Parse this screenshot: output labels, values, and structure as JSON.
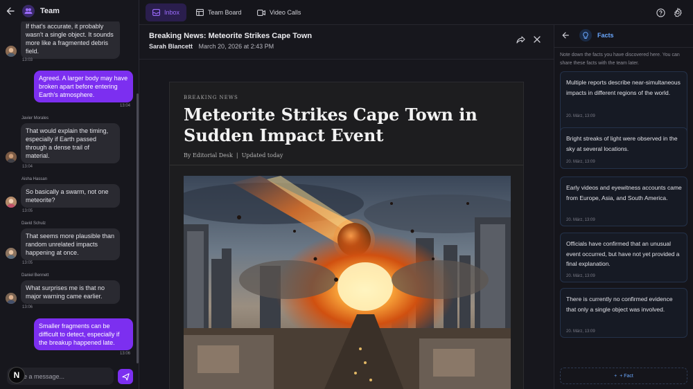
{
  "chat": {
    "title": "Team",
    "composer_placeholder": "Type a message...",
    "composer_visible": "e a message...",
    "messages": [
      {
        "kind": "in",
        "text": "If that's accurate, it probably wasn't a single object. It sounds more like a fragmented debris field.",
        "time": "13:03"
      },
      {
        "kind": "out",
        "text": "Agreed. A larger body may have broken apart before entering Earth's atmosphere.",
        "time": "13:04"
      },
      {
        "kind": "in",
        "sender": "Javier Morales",
        "text": "That would explain the timing, especially if Earth passed through a dense trail of material.",
        "time": "13:04"
      },
      {
        "kind": "in",
        "sender": "Aisha Hassan",
        "text": "So basically a swarm, not one meteorite?",
        "time": "13:05"
      },
      {
        "kind": "in",
        "sender": "David Schulz",
        "text": "That seems more plausible than random unrelated impacts happening at once.",
        "time": "13:05"
      },
      {
        "kind": "in",
        "sender": "Daniel Bennett",
        "text": "What surprises me is that no major warning came earlier.",
        "time": "13:06"
      },
      {
        "kind": "out",
        "text": "Smaller fragments can be difficult to detect, especially if the breakup happened late.",
        "time": "13:06"
      }
    ]
  },
  "nav": {
    "tabs": [
      {
        "label": "Inbox",
        "icon": "inbox-icon"
      },
      {
        "label": "Team Board",
        "icon": "board-icon"
      },
      {
        "label": "Video Calls",
        "icon": "video-icon"
      }
    ]
  },
  "article": {
    "email_title": "Breaking News: Meteorite Strikes Cape Town",
    "author": "Sarah Blancett",
    "date": "March 20, 2026 at 2:43 PM",
    "kicker": "BREAKING NEWS",
    "headline": "Meteorite Strikes Cape Town in Sudden Impact Event",
    "byline": "By Editorial Desk",
    "updated": "Updated today"
  },
  "facts": {
    "title": "Facts",
    "note": "Note down the facts you have discovered here. You can share these facts with the team later.",
    "add_label": "+ Fact",
    "items": [
      {
        "text": "Multiple reports describe near-simultaneous impacts in different regions of the world.",
        "date": "20. März, 13:09"
      },
      {
        "text": "Bright streaks of light were observed in the sky at several locations.",
        "date": "20. März, 13:09"
      },
      {
        "text": "Early videos and eyewitness accounts came from Europe, Asia, and South America.",
        "date": "20. März, 13:09"
      },
      {
        "text": "Officials have confirmed that an unusual event occurred, but have not yet provided a final explanation.",
        "date": "20. März, 13:09"
      },
      {
        "text": "There is currently no confirmed evidence that only a single object was involved.",
        "date": "20. März, 13:09"
      }
    ]
  },
  "colors": {
    "accent": "#7c2ff0",
    "facts_accent": "#6aa8ff",
    "background": "#15151b"
  }
}
